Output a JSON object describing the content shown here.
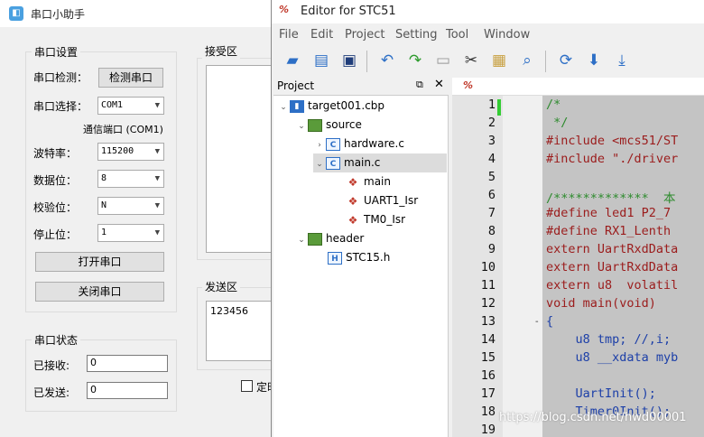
{
  "helper": {
    "title": "串口小助手",
    "settings_group": "串口设置",
    "detect_label": "串口检测：",
    "detect_button": "检测串口",
    "select_label": "串口选择：",
    "select_value": "COM1",
    "port_desc": "通信端口 (COM1)",
    "baud_label": "波特率：",
    "baud_value": "115200",
    "databits_label": "数据位：",
    "databits_value": "8",
    "parity_label": "校验位：",
    "parity_value": "N",
    "stopbits_label": "停止位：",
    "stopbits_value": "1",
    "open_button": "打开串口",
    "close_button": "关闭串口",
    "recv_area_label": "接受区",
    "send_area_label": "发送区",
    "send_text": "123456",
    "status_group": "串口状态",
    "received_label": "已接收:",
    "received_value": "0",
    "sent_label": "已发送:",
    "sent_value": "0",
    "timer_label": "定时"
  },
  "editor": {
    "title": "Editor for STC51",
    "logo_text": "%",
    "menu": [
      "File",
      "Edit",
      "Project",
      "Setting",
      "Tool",
      "Window"
    ],
    "toolbar_icons": [
      "open-folder-icon",
      "book-icon",
      "save-icon",
      "undo-icon",
      "redo-icon",
      "copy-icon",
      "cut-icon",
      "paste-icon",
      "find-icon",
      "refresh-icon",
      "download-icon",
      "download-all-icon"
    ],
    "project_panel_title": "Project",
    "tree": [
      {
        "label": "target001.cbp",
        "type": "project",
        "depth": 0,
        "expanded": true
      },
      {
        "label": "source",
        "type": "folder",
        "depth": 1,
        "expanded": true
      },
      {
        "label": "hardware.c",
        "type": "c-file",
        "depth": 2,
        "expanded": false
      },
      {
        "label": "main.c",
        "type": "c-file",
        "depth": 2,
        "expanded": true,
        "selected": true
      },
      {
        "label": "main",
        "type": "function",
        "depth": 3
      },
      {
        "label": "UART1_Isr",
        "type": "function",
        "depth": 3
      },
      {
        "label": "TM0_Isr",
        "type": "function",
        "depth": 3
      },
      {
        "label": "header",
        "type": "folder",
        "depth": 1,
        "expanded": true
      },
      {
        "label": "STC15.h",
        "type": "h-file",
        "depth": 2
      }
    ],
    "line_numbers": [
      "1",
      "2",
      "3",
      "4",
      "5",
      "6",
      "7",
      "8",
      "9",
      "10",
      "11",
      "12",
      "13",
      "14",
      "15",
      "16",
      "17",
      "18",
      "19"
    ],
    "code_lines": [
      {
        "text": "/*",
        "color": "green"
      },
      {
        "text": " */",
        "color": "green"
      },
      {
        "text": "#include <mcs51/ST",
        "color": "red"
      },
      {
        "text": "#include \"./driver",
        "color": "red"
      },
      {
        "text": "",
        "color": "dark"
      },
      {
        "text": "/*************  本",
        "color": "green"
      },
      {
        "text": "#define led1 P2_7",
        "color": "red"
      },
      {
        "text": "#define RX1_Lenth",
        "color": "red"
      },
      {
        "text": "extern UartRxdData",
        "color": "red"
      },
      {
        "text": "extern UartRxdData",
        "color": "red"
      },
      {
        "text": "extern u8  volatil",
        "color": "red"
      },
      {
        "text": "void main(void)",
        "color": "red"
      },
      {
        "text": "{",
        "color": "blue"
      },
      {
        "text": "    u8 tmp; //,i;",
        "color": "blue"
      },
      {
        "text": "    u8 __xdata myb",
        "color": "blue"
      },
      {
        "text": "",
        "color": "dark"
      },
      {
        "text": "    UartInit();",
        "color": "blue"
      },
      {
        "text": "    Timer0Init();",
        "color": "blue"
      },
      {
        "text": "",
        "color": "dark"
      }
    ]
  },
  "watermark": "https://blog.csdn.net/hwd00001"
}
